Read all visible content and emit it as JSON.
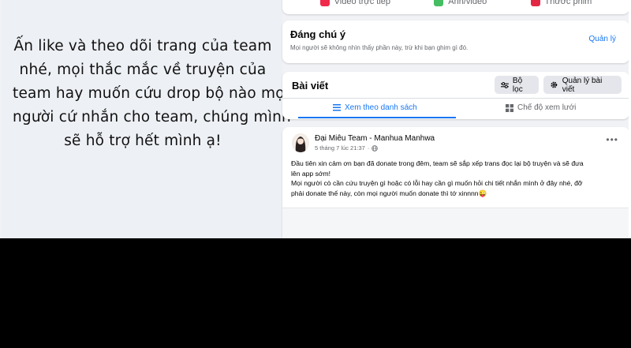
{
  "left_message": {
    "lines": [
      "Ấn like và theo dõi trang của team",
      "nhé, mọi thắc mắc về truyện của",
      "team hay muốn cứu drop bộ nào mọi",
      "người cứ nhắn cho team, chúng mình",
      "sẽ hỗ trợ hết mình ạ!"
    ]
  },
  "composer": {
    "buttons": [
      {
        "label": "Video trực tiếp",
        "color": "#f02849"
      },
      {
        "label": "Ảnh/video",
        "color": "#45bd62"
      },
      {
        "label": "Thước phim",
        "color": "#e42645"
      }
    ]
  },
  "pinned": {
    "title": "Đáng chú ý",
    "subtitle": "Mọi người sẽ không nhìn thấy phần này, trừ khi bạn ghim gì đó.",
    "manage_label": "Quản lý"
  },
  "posts_section": {
    "title": "Bài viết",
    "filter_label": "Bộ lọc",
    "manage_label": "Quản lý bài viết",
    "tab_list_label": "Xem theo danh sách",
    "tab_grid_label": "Chế độ xem lưới"
  },
  "post": {
    "author": "Đại Miêu Team - Manhua Manhwa",
    "timestamp": "5 tháng 7 lúc 21:37",
    "lines": [
      "Đầu tiên xin cảm ơn bạn đã donate trong đêm, team sẽ sắp xếp trans đọc lại bộ truyện và sẽ đưa",
      "lên app sớm!",
      "Mọi người cò cần cứu truyện gì hoặc có lỗi hay cần gì muốn hỏi chi tiết nhắn mình ở đây nhé, đỡ",
      "phải donate thế này, còn mọi người muốn donate thì tớ xinnnn😜"
    ]
  },
  "colors": {
    "accent": "#1877f2",
    "page_bg": "#f0f2f5",
    "left_bg": "#edf0f4"
  }
}
